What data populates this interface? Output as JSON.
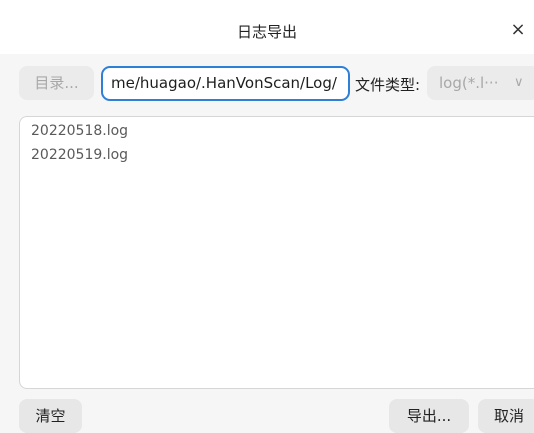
{
  "window": {
    "title": "日志导出",
    "close_glyph": "×"
  },
  "toolbar": {
    "dir_button_label": "目录...",
    "path_value": "me/huagao/.HanVonScan/Log/",
    "filetype_label": "文件类型:",
    "filetype_value": "log(*.l···",
    "filetype_chevron": "∨"
  },
  "file_list": {
    "items": [
      "20220518.log",
      "20220519.log"
    ]
  },
  "footer": {
    "clear_label": "清空",
    "export_label": "导出...",
    "cancel_label": "取消"
  },
  "colors": {
    "accent": "#2f7fd6",
    "dialog_bg": "#f6f6f6",
    "button_bg": "#e7e7e7",
    "disabled_text": "#a8a8a8"
  },
  "icons": {
    "close": "close-icon",
    "chevron": "chevron-down-icon"
  }
}
